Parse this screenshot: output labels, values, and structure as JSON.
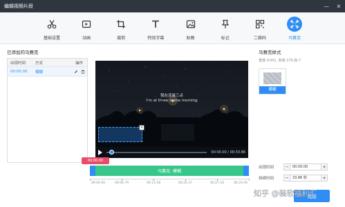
{
  "window": {
    "title": "编辑视频片段",
    "controls": {
      "minimize": "—",
      "close": "✕"
    }
  },
  "toolbar": {
    "tools": [
      {
        "label": "基础设置",
        "icon": "scissors-icon"
      },
      {
        "label": "动画",
        "icon": "animation-icon"
      },
      {
        "label": "裁剪",
        "icon": "crop-icon"
      },
      {
        "label": "特效字幕",
        "icon": "text-icon"
      },
      {
        "label": "贴图",
        "icon": "image-icon"
      },
      {
        "label": "标记",
        "icon": "pin-icon"
      },
      {
        "label": "二维码",
        "icon": "qrcode-icon"
      },
      {
        "label": "马赛克",
        "icon": "mosaic-icon",
        "active": true
      }
    ]
  },
  "mosaic_list": {
    "title": "已添加的马赛克",
    "headers": [
      "出现时间",
      "方式",
      "操作"
    ],
    "rows": [
      {
        "time": "00:00.00",
        "mode": "模糊"
      }
    ]
  },
  "video": {
    "caption_cn": "我在凌晨三点",
    "caption_en": "I'm at three in the morning",
    "time": "00:00.00 / 00:33.86",
    "progress": 0.0
  },
  "mosaic_style": {
    "title": "马赛克样式",
    "hint": "宽度:X(45), 高度:276,高:7",
    "card_label": "模糊"
  },
  "timeline": {
    "current": "00:00.00",
    "clip_label": "马赛克: 模糊",
    "ticks": [
      "00:00.00",
      "00:06.79",
      "00:13.58",
      "00:20.37",
      "00:27.16",
      "00:33.95"
    ]
  },
  "fields": {
    "appear": {
      "label": "出现时间",
      "value": "00:00.00"
    },
    "duration": {
      "label": "持续时间",
      "value": "33.86 秒"
    }
  },
  "buttons": {
    "confirm": "完成"
  },
  "watermark": "知乎 @装软福利汇",
  "colors": {
    "accent": "#2e8ef5",
    "clip": "#37c78a",
    "marker": "#e84c68",
    "titlebar": "#2f3640"
  }
}
